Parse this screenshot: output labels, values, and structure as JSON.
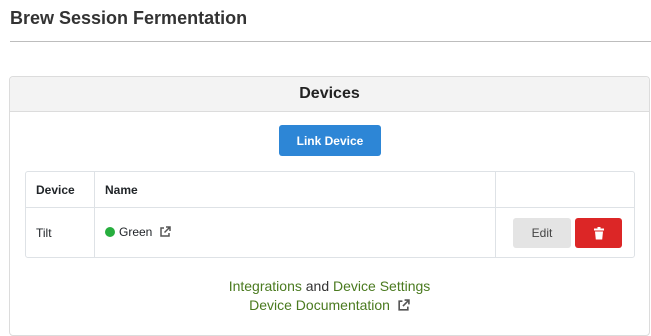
{
  "page": {
    "title": "Brew Session Fermentation"
  },
  "devices_card": {
    "title": "Devices",
    "link_button_label": "Link Device",
    "table": {
      "headers": [
        "Device",
        "Name",
        ""
      ],
      "rows": [
        {
          "device": "Tilt",
          "name": "Green",
          "status_color": "#27ae3e",
          "edit_label": "Edit"
        }
      ]
    },
    "footer": {
      "integrations_label": "Integrations",
      "and_label": "and",
      "device_settings_label": "Device Settings",
      "documentation_label": "Device Documentation"
    }
  },
  "colors": {
    "primary_button": "#2d86d6",
    "danger_button": "#dc2626",
    "link": "#4a7a1f"
  },
  "icons": {
    "external_link": "external-link-icon",
    "delete": "trash-icon",
    "status": "status-dot"
  }
}
